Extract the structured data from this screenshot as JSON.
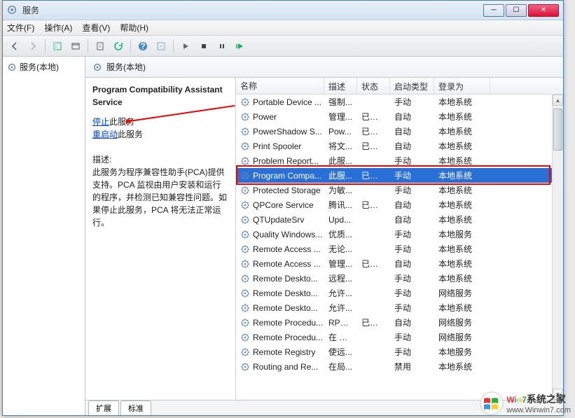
{
  "window": {
    "title": "服务"
  },
  "menus": {
    "file": "文件(F)",
    "action": "操作(A)",
    "view": "查看(V)",
    "help": "帮助(H)"
  },
  "left_tree": {
    "root": "服务(本地)"
  },
  "right_header": {
    "title": "服务(本地)"
  },
  "detail": {
    "title": "Program Compatibility Assistant Service",
    "stop_prefix": "停止",
    "stop_suffix": "此服务",
    "restart_prefix": "重启动",
    "restart_suffix": "此服务",
    "desc_label": "描述:",
    "description": "此服务为程序兼容性助手(PCA)提供支持。PCA 监视由用户安装和运行的程序，并检测已知兼容性问题。如果停止此服务，PCA 将无法正常运行。"
  },
  "columns": {
    "name": "名称",
    "desc": "描述",
    "status": "状态",
    "startup": "启动类型",
    "logon": "登录为"
  },
  "rows": [
    {
      "name": "Portable Device ...",
      "desc": "强制...",
      "status": "",
      "startup": "手动",
      "logon": "本地系统"
    },
    {
      "name": "Power",
      "desc": "管理...",
      "status": "已启动",
      "startup": "自动",
      "logon": "本地系统"
    },
    {
      "name": "PowerShadow S...",
      "desc": "Pow...",
      "status": "已启动",
      "startup": "自动",
      "logon": "本地系统"
    },
    {
      "name": "Print Spooler",
      "desc": "将文...",
      "status": "已启动",
      "startup": "自动",
      "logon": "本地系统"
    },
    {
      "name": "Problem Report...",
      "desc": "此服...",
      "status": "",
      "startup": "手动",
      "logon": "本地系统"
    },
    {
      "name": "Program Compa...",
      "desc": "此服...",
      "status": "已启动",
      "startup": "手动",
      "logon": "本地系统",
      "selected": true
    },
    {
      "name": "Protected Storage",
      "desc": "为敏...",
      "status": "",
      "startup": "手动",
      "logon": "本地系统"
    },
    {
      "name": "QPCore Service",
      "desc": "腾讯...",
      "status": "已启动",
      "startup": "自动",
      "logon": "本地系统"
    },
    {
      "name": "QTUpdateSrv",
      "desc": "Upd...",
      "status": "",
      "startup": "自动",
      "logon": "本地系统"
    },
    {
      "name": "Quality Windows...",
      "desc": "优质...",
      "status": "",
      "startup": "手动",
      "logon": "本地服务"
    },
    {
      "name": "Remote Access ...",
      "desc": "无论...",
      "status": "",
      "startup": "手动",
      "logon": "本地系统"
    },
    {
      "name": "Remote Access ...",
      "desc": "管理...",
      "status": "已启动",
      "startup": "自动",
      "logon": "本地系统"
    },
    {
      "name": "Remote Deskto...",
      "desc": "远程...",
      "status": "",
      "startup": "手动",
      "logon": "本地系统"
    },
    {
      "name": "Remote Deskto...",
      "desc": "允许...",
      "status": "",
      "startup": "手动",
      "logon": "网络服务"
    },
    {
      "name": "Remote Deskto...",
      "desc": "允许...",
      "status": "",
      "startup": "手动",
      "logon": "本地系统"
    },
    {
      "name": "Remote Procedu...",
      "desc": "RPC...",
      "status": "已启动",
      "startup": "自动",
      "logon": "网络服务"
    },
    {
      "name": "Remote Procedu...",
      "desc": "在 W...",
      "status": "",
      "startup": "手动",
      "logon": "网络服务"
    },
    {
      "name": "Remote Registry",
      "desc": "使远...",
      "status": "",
      "startup": "手动",
      "logon": "本地服务"
    },
    {
      "name": "Routing and Re...",
      "desc": "在局...",
      "status": "",
      "startup": "禁用",
      "logon": "本地系统"
    }
  ],
  "tabs": {
    "extended": "扩展",
    "standard": "标准"
  },
  "watermark": {
    "brand": "Win7系统之家",
    "url": "www.Winwin7.com"
  }
}
